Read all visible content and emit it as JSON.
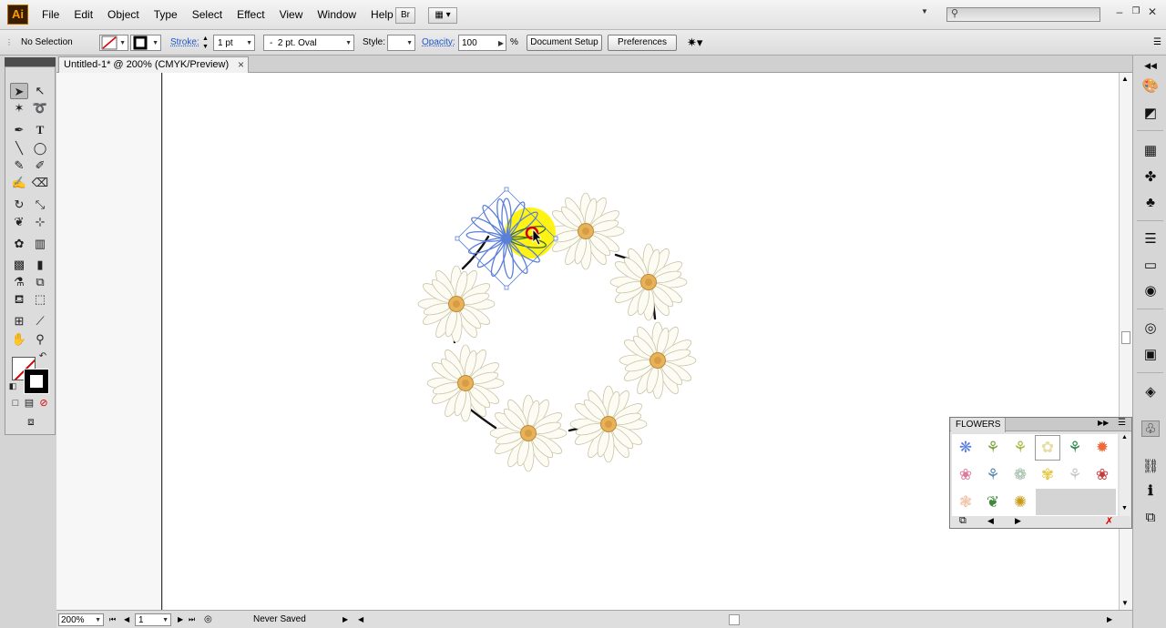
{
  "app": {
    "logo": "Ai"
  },
  "menu": [
    "File",
    "Edit",
    "Object",
    "Type",
    "Select",
    "Effect",
    "View",
    "Window",
    "Help"
  ],
  "menubar": {
    "bridge_label": "Br"
  },
  "control": {
    "selection": "No Selection",
    "stroke_label": "Stroke:",
    "stroke_value": "1 pt",
    "brush": "2 pt. Oval",
    "brush_prefix": "-",
    "style_label": "Style:",
    "opacity_label": "Opacity:",
    "opacity_value": "100",
    "opacity_unit": "%",
    "document_setup": "Document Setup",
    "preferences": "Preferences"
  },
  "document": {
    "tab_title": "Untitled-1* @ 200% (CMYK/Preview)",
    "close": "×"
  },
  "status": {
    "zoom": "200%",
    "artboard": "1",
    "save_state": "Never Saved"
  },
  "flowers_panel": {
    "title": "FLOWERS",
    "symbols": [
      "cornflower",
      "bellflower",
      "wild-stem",
      "daisy",
      "tulip-bud",
      "gerbera",
      "pink-rose",
      "orchid-stem",
      "lotus",
      "lily",
      "dandelion",
      "red-rose",
      "peony",
      "leaf-sprig",
      "sunflower"
    ],
    "selected_index": 3
  },
  "colors": {
    "daisy_petal": "#fdfcf4",
    "daisy_center": "#e6b35a",
    "selection": "#5b7fd9",
    "highlight": "#fff200"
  }
}
